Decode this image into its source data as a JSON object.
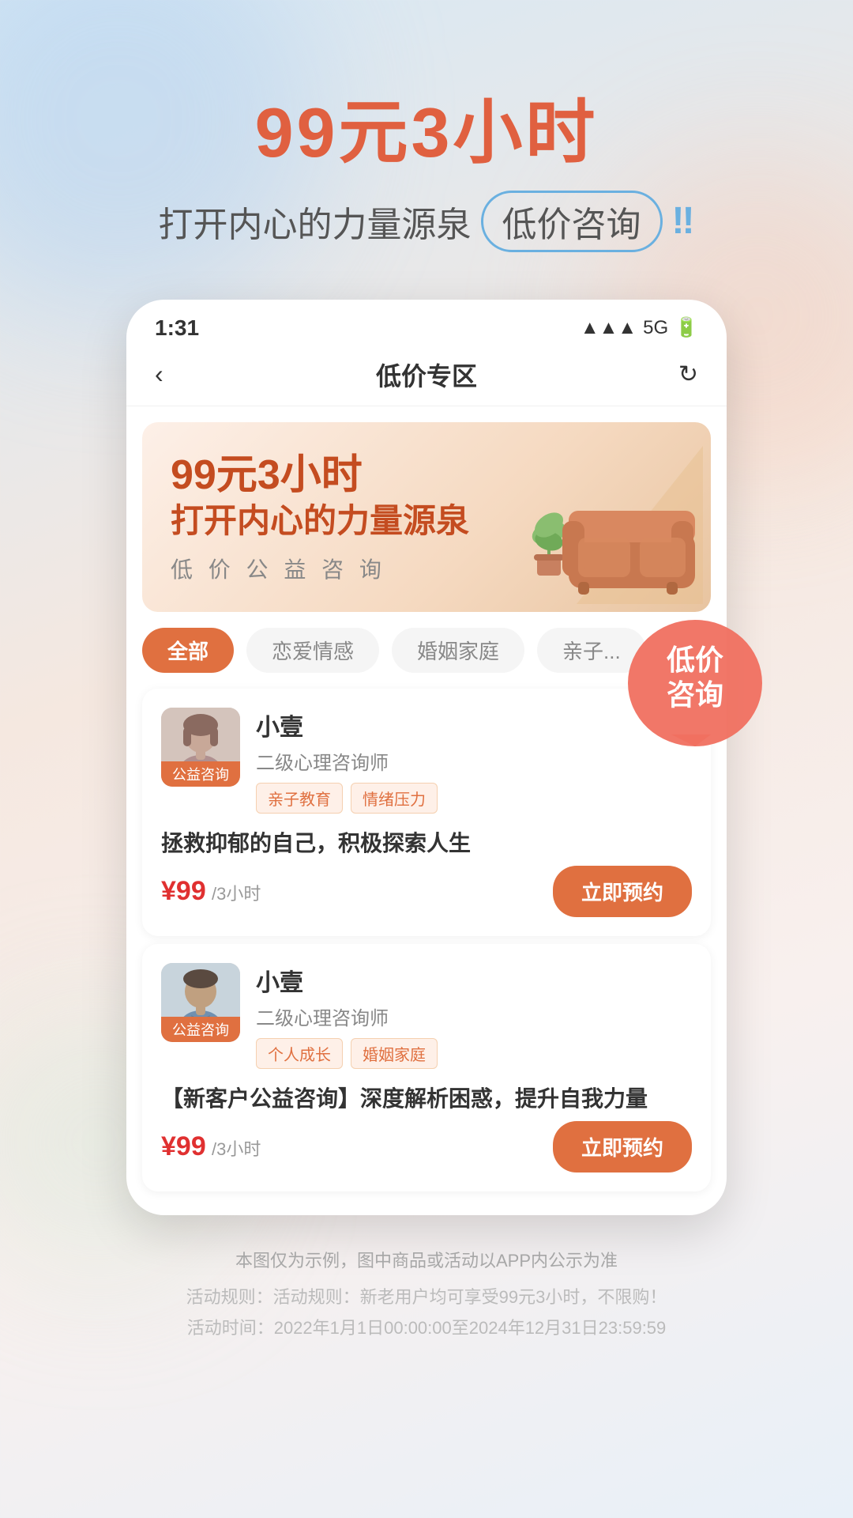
{
  "hero": {
    "title": "99元3小时",
    "subtitle_text": "打开内心的力量源泉",
    "subtitle_highlight": "低价咨询",
    "exclamation": "‼"
  },
  "phone": {
    "status_time": "1:31",
    "status_signal": "▲",
    "status_network": "5G",
    "nav_title": "低价专区"
  },
  "banner": {
    "line1": "99元3小时",
    "line2": "打开内心的力量源泉",
    "subtitle": "低 价 公 益 咨 询"
  },
  "categories": [
    {
      "label": "全部",
      "active": true
    },
    {
      "label": "恋爱情感",
      "active": false
    },
    {
      "label": "婚姻家庭",
      "active": false
    },
    {
      "label": "亲子...",
      "active": false
    }
  ],
  "counselors": [
    {
      "name": "小壹",
      "level": "二级心理咨询师",
      "badge": "公益咨询",
      "tags": [
        "亲子教育",
        "情绪压力"
      ],
      "desc": "拯救抑郁的自己，积极探索人生",
      "price": "¥99",
      "price_unit": "/3小时",
      "button": "立即预约",
      "avatar_gender": "female"
    },
    {
      "name": "小壹",
      "level": "二级心理咨询师",
      "badge": "公益咨询",
      "tags": [
        "个人成长",
        "婚姻家庭"
      ],
      "desc": "【新客户公益咨询】深度解析困惑，提升自我力量",
      "price": "¥99",
      "price_unit": "/3小时",
      "button": "立即预约",
      "avatar_gender": "male"
    }
  ],
  "floating_badge": {
    "line1": "低价",
    "line2": "咨询"
  },
  "disclaimer": {
    "main": "本图仅为示例，图中商品或活动以APP内公示为准",
    "rules_label": "活动规则：活动规则：新老用户均可享受99元3小时，不限购！",
    "time_label": "活动时间：2022年1月1日00:00:00至2024年12月31日23:59:59"
  }
}
